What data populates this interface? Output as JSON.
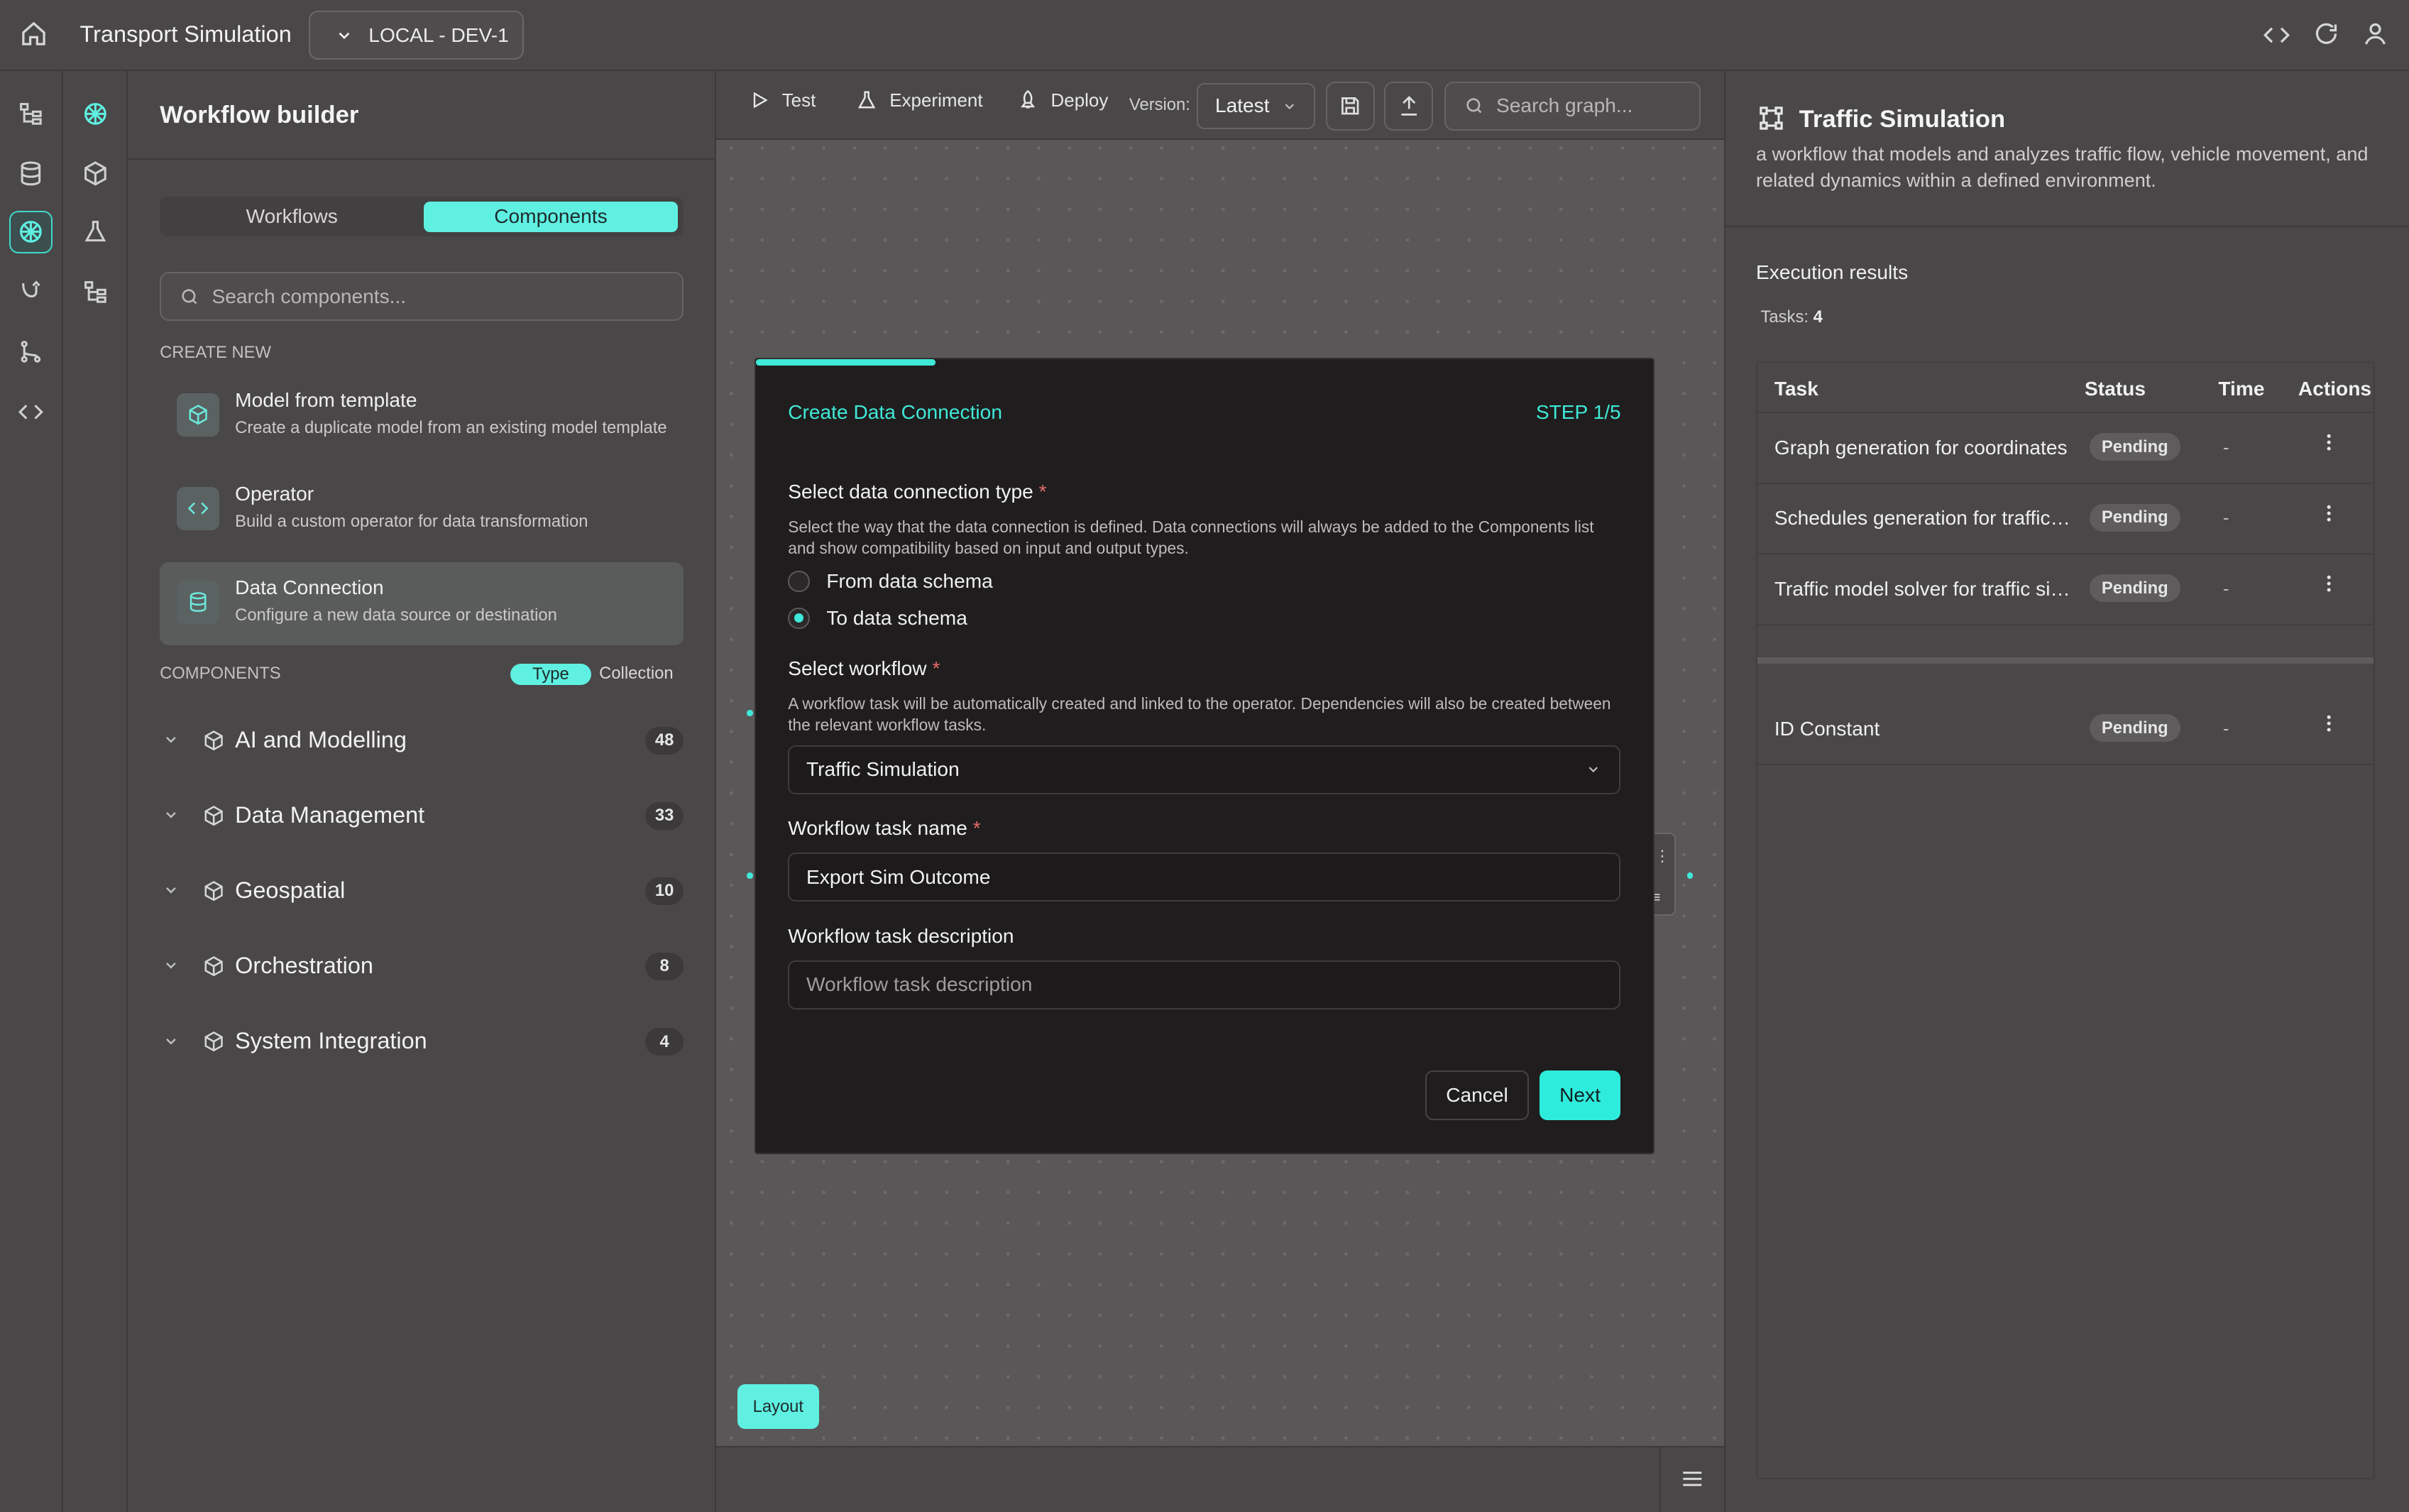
{
  "app": {
    "title": "Transport Simulation",
    "environment": "LOCAL - DEV-1"
  },
  "sidebar": {
    "rail_icons": [
      "tree-icon",
      "database-icon",
      "network-brain-icon",
      "hook-icon",
      "branch-icon",
      "code-icon"
    ],
    "rail2_icons": [
      "network-brain-icon",
      "cube-icon",
      "flask-icon",
      "tree-icon"
    ]
  },
  "left_panel": {
    "title": "Workflow builder",
    "tabs": [
      "Workflows",
      "Components"
    ],
    "active_tab": "Components",
    "search_placeholder": "Search components...",
    "create_new_heading": "CREATE NEW",
    "create_items": [
      {
        "title": "Model from template",
        "description": "Create a duplicate model from an existing model template",
        "icon": "cube-icon"
      },
      {
        "title": "Operator",
        "description": "Build a custom operator for data transformation",
        "icon": "code-icon"
      },
      {
        "title": "Data Connection",
        "description": "Configure a new data source or destination",
        "icon": "database-icon",
        "selected": true
      }
    ],
    "components_heading": "COMPONENTS",
    "view_toggle": [
      "Type",
      "Collection"
    ],
    "groups": [
      {
        "label": "AI and Modelling",
        "count": "48"
      },
      {
        "label": "Data Management",
        "count": "33"
      },
      {
        "label": "Geospatial",
        "count": "10"
      },
      {
        "label": "Orchestration",
        "count": "8"
      },
      {
        "label": "System Integration",
        "count": "4"
      }
    ]
  },
  "toolbar": {
    "test": "Test",
    "experiment": "Experiment",
    "deploy": "Deploy",
    "version_label": "Version:",
    "version_value": "Latest",
    "search_placeholder": "Search graph..."
  },
  "canvas": {
    "layout_button": "Layout"
  },
  "modal": {
    "title": "Create Data Connection",
    "step": "STEP 1/5",
    "progress": 0.2,
    "conn_type_label": "Select data connection type",
    "conn_type_hint": "Select the way that the data connection is defined. Data connections will always be added to the Components list and show compatibility based on input and output types.",
    "radio_options": [
      "From data schema",
      "To data schema"
    ],
    "radio_selected": "To data schema",
    "workflow_label": "Select workflow",
    "workflow_hint": "A workflow task will be automatically created and linked to the operator. Dependencies will also be created between the relevant workflow tasks.",
    "workflow_value": "Traffic Simulation",
    "task_name_label": "Workflow task name",
    "task_name_value": "Export Sim Outcome",
    "task_desc_label": "Workflow task description",
    "task_desc_placeholder": "Workflow task description",
    "cancel": "Cancel",
    "next": "Next"
  },
  "right_panel": {
    "title": "Traffic Simulation",
    "description": "a workflow that models and analyzes traffic flow, vehicle movement, and related dynamics within a defined environment.",
    "results_heading": "Execution results",
    "tasks_label": "Tasks:",
    "tasks_count": "4",
    "columns": [
      "Task",
      "Status",
      "Time",
      "Actions"
    ],
    "rows": [
      {
        "task": "Graph generation for coordinates",
        "status": "Pending",
        "time": "-"
      },
      {
        "task": "Schedules generation for traffic s...",
        "status": "Pending",
        "time": "-"
      },
      {
        "task": "Traffic model solver for traffic sim...",
        "status": "Pending",
        "time": "-"
      },
      {
        "task": "ID Constant",
        "status": "Pending",
        "time": "-"
      }
    ]
  },
  "colors": {
    "accent": "#40e8d8",
    "background": "#5a5758",
    "panel": "#4a4748",
    "modal": "#1f1d1d"
  }
}
